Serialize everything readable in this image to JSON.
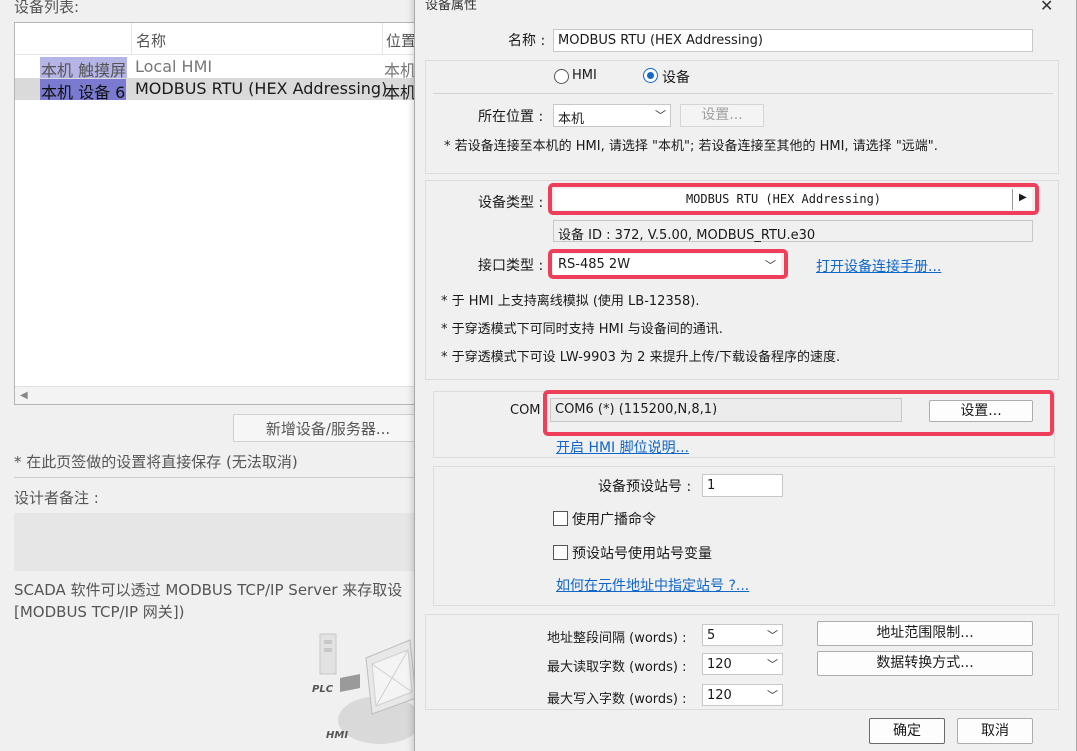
{
  "background": {
    "device_list_label": "设备列表:",
    "columns": [
      "名称",
      "位置"
    ],
    "rows": [
      {
        "id": "本机 触摸屏",
        "name": "Local HMI",
        "location": "本机"
      },
      {
        "id": "本机 设备 6",
        "name": "MODBUS RTU (HEX Addressing)",
        "location": "本机"
      }
    ],
    "add_device_button": "新增设备/服务器...",
    "save_note": "* 在此页签做的设置将直接保存 (无法取消)",
    "designer_notes_label": "设计者备注 :",
    "scada_text_line1": "SCADA 软件可以透过 MODBUS TCP/IP Server 来存取设",
    "scada_text_line2": "[MODBUS TCP/IP 网关])",
    "diagram_labels": [
      "PLC",
      "HMI"
    ]
  },
  "dialog": {
    "title": "设备属性",
    "name_label": "名称 :",
    "name_value": "MODBUS RTU (HEX Addressing)",
    "radio_hmi": "HMI",
    "radio_device": "设备",
    "location_label": "所在位置 :",
    "location_value": "本机",
    "location_settings_button": "设置...",
    "location_note": "* 若设备连接至本机的 HMI, 请选择 \"本机\"; 若设备连接至其他的 HMI, 请选择 \"远端\".",
    "device_type_label": "设备类型 :",
    "device_type_value": "MODBUS RTU (HEX Addressing)",
    "device_id": "设备 ID : 372, V.5.00, MODBUS_RTU.e30",
    "interface_label": "接口类型 :",
    "interface_value": "RS-485 2W",
    "manual_link": "打开设备连接手册...",
    "notes": [
      "* 于 HMI 上支持离线模拟 (使用 LB-12358).",
      "* 于穿透模式下可同时支持 HMI 与设备间的通讯.",
      "* 于穿透模式下可设 LW-9903 为 2 来提升上传/下载设备程序的速度."
    ],
    "com_label": "COM",
    "com_value": "COM6 (*) (115200,N,8,1)",
    "com_settings_button": "设置...",
    "pin_link": "开启 HMI 脚位说明...",
    "station_label": "设备预设站号 :",
    "station_value": "1",
    "broadcast_label": "使用广播命令",
    "station_var_label": "预设站号使用站号变量",
    "station_link": "如何在元件地址中指定站号 ?...",
    "addr_interval_label": "地址整段间隔 (words) :",
    "addr_interval_value": "5",
    "max_read_label": "最大读取字数 (words) :",
    "max_read_value": "120",
    "max_write_label": "最大写入字数 (words) :",
    "max_write_value": "120",
    "addr_limit_button": "地址范围限制...",
    "data_conv_button": "数据转换方式...",
    "ok_button": "确定",
    "cancel_button": "取消"
  },
  "colors": {
    "highlight": "#ef3e5a",
    "link": "#1066c9",
    "selection": "#7a7ad0"
  }
}
